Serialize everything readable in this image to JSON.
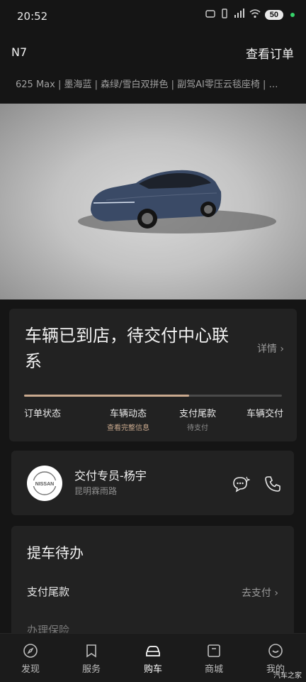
{
  "status_bar": {
    "time": "20:52",
    "battery": "50"
  },
  "header": {
    "model": "N7",
    "view_order": "查看订单"
  },
  "config_line": "625 Max | 墨海蓝 | 森绿/雪白双拼色 | 副驾AI零压云毯座椅 | …",
  "order_status": {
    "title": "车辆已到店，待交付中心联系",
    "detail_link": "详情 ›",
    "progress": 0.64,
    "steps": [
      {
        "label": "订单状态",
        "sub": ""
      },
      {
        "label": "车辆动态",
        "sub": "查看完整信息"
      },
      {
        "label": "支付尾款",
        "sub": "待支付"
      },
      {
        "label": "车辆交付",
        "sub": ""
      }
    ],
    "colors": {
      "accent": "#c9a98e"
    }
  },
  "contact": {
    "name": "交付专员-杨宇",
    "store": "昆明霖雨路",
    "avatar_text": "NISSAN",
    "chat_icon": "chat-bubble-icon",
    "phone_icon": "phone-icon"
  },
  "todo": {
    "title": "提车待办",
    "items": [
      {
        "label": "支付尾款",
        "action": "去支付 ›"
      },
      {
        "label": "办理保险",
        "action": ""
      }
    ]
  },
  "bottom_nav": [
    {
      "label": "发现",
      "icon": "compass-icon"
    },
    {
      "label": "服务",
      "icon": "bookmark-icon"
    },
    {
      "label": "购车",
      "icon": "car-icon",
      "active": true
    },
    {
      "label": "商城",
      "icon": "shop-icon"
    },
    {
      "label": "我的",
      "icon": "smile-icon"
    }
  ],
  "watermark": "汽车之家"
}
